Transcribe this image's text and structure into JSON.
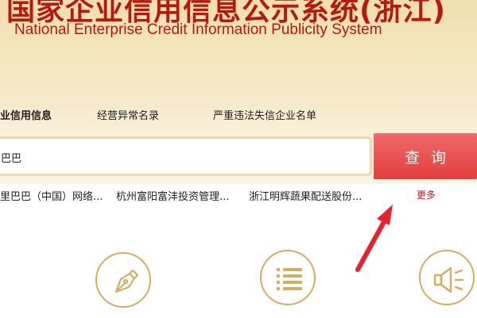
{
  "header": {
    "title_cn": "国家企业信用信息公示系统(浙江)",
    "title_en": "National Enterprise Credit Information Publicity System"
  },
  "tabs": [
    {
      "label": "业信用信息",
      "active": true
    },
    {
      "label": "经营异常名录",
      "active": false
    },
    {
      "label": "严重违法失信企业名单",
      "active": false
    }
  ],
  "search": {
    "value": "巴巴",
    "button_label": "查询"
  },
  "suggestions": [
    "里巴巴（中国）网络...",
    "杭州富阳富沣投资管理...",
    "浙江明辉蔬果配送股份..."
  ],
  "more_label": "更多",
  "icons": [
    "pen-icon",
    "list-icon",
    "speaker-icon"
  ],
  "colors": {
    "brand_red": "#b8180e",
    "button_red": "#e84848",
    "icon_gold": "#d4ad62",
    "arrow_red": "#e8222c"
  }
}
